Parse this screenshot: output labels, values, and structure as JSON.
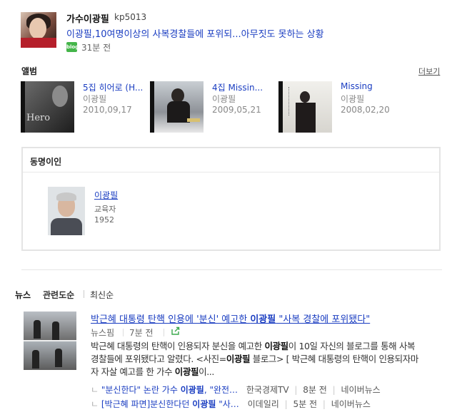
{
  "blog": {
    "author": "가수이광필",
    "id": "kp5013",
    "title": "이광필,10여명이상의 사복경찰들에 포위되...아무짓도 못하는 상황",
    "badge": "blog",
    "time": "31분 전"
  },
  "albums": {
    "heading": "앨범",
    "more": "더보기",
    "items": [
      {
        "title": "5집 히어로 (H...",
        "artist": "이광필",
        "date": "2010,09,17",
        "cover_text": "Hero"
      },
      {
        "title": "4집 Missin...",
        "artist": "이광필",
        "date": "2009,05,21",
        "cover_text": ""
      },
      {
        "title": "Missing",
        "artist": "이광필",
        "date": "2008,02,20",
        "cover_text": ""
      }
    ]
  },
  "namesake": {
    "heading": "동명이인",
    "person": {
      "name": "이광필",
      "job": "교육자",
      "year": "1952"
    }
  },
  "news": {
    "tabs": [
      "뉴스",
      "관련도순",
      "최신순"
    ],
    "article": {
      "title_pre": "박근혜 대통령 탄핵 인용에 '분신' 예고한 ",
      "title_name": "이광필",
      "title_post": " \"사복 경찰에 포위됐다\"",
      "source": "뉴스핌",
      "time": "7분 전",
      "body_1": "박근혜 대통령의 탄핵이 인용되자 분신을 예고한 ",
      "body_name_1": "이광필",
      "body_2": "이 10일 자신의 블로그를 통해 사복",
      "body_3": "경찰들에 포위됐다고 알렸다. <사진=",
      "body_name_2": "이광필",
      "body_4": " 블로그> [ 박근혜 대통령의 탄핵이 인용되자마",
      "body_5": "자 자살 예고를 한 가수 ",
      "body_name_3": "이광필",
      "body_6": "이..."
    },
    "related": [
      {
        "pre": "\"분신한다\" 논란 가수 ",
        "name": "이광필",
        "post": ", \"완전…",
        "source": "한국경제TV",
        "time": "8분 전",
        "portal": "네이버뉴스"
      },
      {
        "pre": "[박근혜 파면]분신한다던 ",
        "name": "이광필",
        "post": " \"사…",
        "source": "이데일리",
        "time": "5분 전",
        "portal": "네이버뉴스"
      }
    ]
  }
}
